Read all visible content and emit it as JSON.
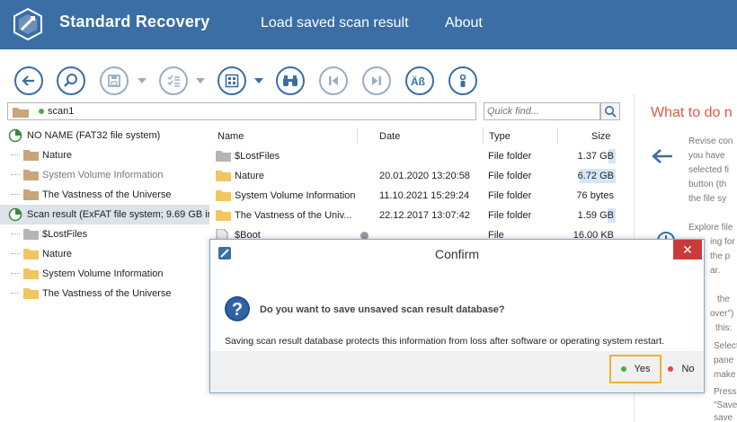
{
  "header": {
    "app_title": "Standard Recovery",
    "menu": [
      {
        "label": "Load saved scan result"
      },
      {
        "label": "About"
      }
    ],
    "bg_color": "#3a6ea5"
  },
  "toolbar": {
    "buttons": [
      "back-icon",
      "search-scan-icon",
      "save-icon",
      "list-options-icon",
      "view-mode-icon",
      "find-icon",
      "previous-icon",
      "next-icon",
      "case-sensitive-icon",
      "info-icon"
    ]
  },
  "pathbar": {
    "path": "scan1"
  },
  "search": {
    "placeholder": "Quick find..."
  },
  "tree": {
    "items": [
      {
        "label": "NO NAME (FAT32 file system)",
        "type": "drive"
      },
      {
        "label": "Nature",
        "type": "folder"
      },
      {
        "label": "System Volume Information",
        "type": "folder"
      },
      {
        "label": "The Vastness of the Universe",
        "type": "folder"
      },
      {
        "label": "Scan result (ExFAT file system; 9.69 GB in",
        "type": "drive",
        "selected": true
      },
      {
        "label": "$LostFiles",
        "type": "folder"
      },
      {
        "label": "Nature",
        "type": "folder"
      },
      {
        "label": "System Volume Information",
        "type": "folder"
      },
      {
        "label": "The Vastness of the Universe",
        "type": "folder"
      }
    ]
  },
  "filelist": {
    "columns": {
      "name": "Name",
      "date": "Date",
      "type": "Type",
      "size": "Size"
    },
    "rows": [
      {
        "name": "$LostFiles",
        "date": "",
        "type": "File folder",
        "size": "1.37 GB",
        "fill": 0.14
      },
      {
        "name": "Nature",
        "date": "20.01.2020 13:20:58",
        "type": "File folder",
        "size": "6.72 GB",
        "fill": 0.69
      },
      {
        "name": "System Volume Information",
        "date": "11.10.2021 15:29:24",
        "type": "File folder",
        "size": "76 bytes",
        "fill": 0
      },
      {
        "name": "The Vastness of the Univ...",
        "date": "22.12.2017 13:07:42",
        "type": "File folder",
        "size": "1.59 GB",
        "fill": 0.16
      },
      {
        "name": "$Boot",
        "date": "",
        "type": "File",
        "size": "16.00 KB",
        "fill": 0
      }
    ]
  },
  "right_panel": {
    "title": "What to do n",
    "lines1": [
      "Revise con",
      "you have",
      "selected fi",
      "button (th",
      "the file sy"
    ],
    "lines2": [
      "Explore file",
      "ing for",
      "the p",
      "ar."
    ],
    "lines3": [
      "the",
      "over\")",
      "this:",
      "Select",
      "pane",
      "make",
      "Press",
      "\"Save",
      "save"
    ]
  },
  "dialog": {
    "title": "Confirm",
    "close": "✕",
    "question": "Do you want to save unsaved scan result database?",
    "info": "Saving scan result database protects this information from loss after software or operating system restart.",
    "yes_label": "Yes",
    "no_label": "No",
    "yes_color": "#4aaa4a",
    "no_color": "#e04848"
  }
}
